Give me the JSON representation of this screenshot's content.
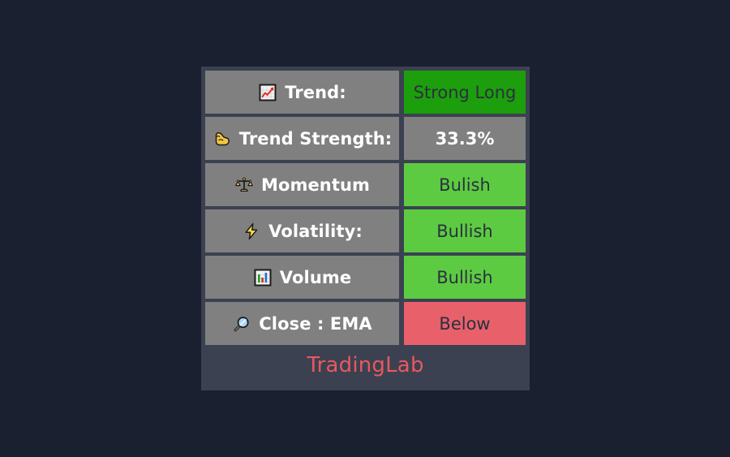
{
  "panel": {
    "background_color": "#3b4150",
    "page_background_color": "#1b2030",
    "label_cell_color": "#808080",
    "rows": [
      {
        "icon": "chart-increasing-icon",
        "label": "Trend:",
        "value": "Strong Long",
        "value_style": "strong-green",
        "value_color": "#1d9e0c"
      },
      {
        "icon": "flexed-biceps-icon",
        "label": "Trend Strength:",
        "value": "33.3%",
        "value_style": "neutral",
        "value_color": "#808080"
      },
      {
        "icon": "balance-scale-icon",
        "label": "Momentum",
        "value": "Bulish",
        "value_style": "green",
        "value_color": "#5ccb41"
      },
      {
        "icon": "lightning-bolt-icon",
        "label": "Volatility:",
        "value": "Bullish",
        "value_style": "green",
        "value_color": "#5ccb41"
      },
      {
        "icon": "bar-chart-icon",
        "label": "Volume",
        "value": "Bullish",
        "value_style": "green",
        "value_color": "#5ccb41"
      },
      {
        "icon": "magnifying-glass-icon",
        "label": "Close : EMA",
        "value": "Below",
        "value_style": "red",
        "value_color": "#e8616a"
      }
    ],
    "footer": {
      "text": "TradingLab",
      "color": "#e8585f"
    }
  }
}
